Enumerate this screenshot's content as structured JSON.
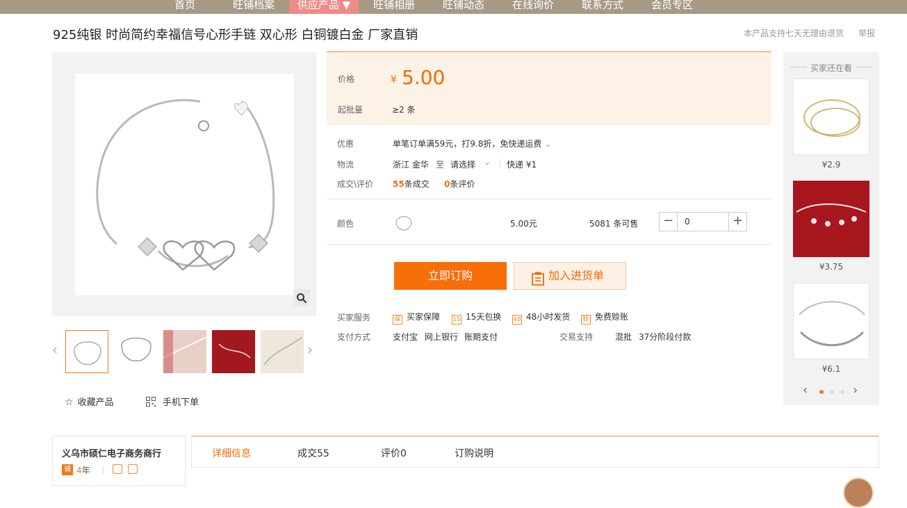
{
  "nav": {
    "items": [
      "首页",
      "旺铺档案",
      "供应产品 ▼",
      "旺铺相册",
      "旺铺动态",
      "在线询价",
      "联系方式",
      "会员专区"
    ]
  },
  "product": {
    "title": "925纯银 时尚简约幸福信号心形手链 双心形 白铜镀白金 厂家直销",
    "return_policy": "本产品支持七天无理由退货",
    "report": "举报"
  },
  "actions": {
    "favorite": "收藏产品",
    "mobile_order": "手机下单"
  },
  "price": {
    "label": "价格",
    "currency": "¥",
    "value": "5.00",
    "moq_label": "起批量",
    "moq_value": "≥2 条"
  },
  "promo": {
    "label": "优惠",
    "text": "单笔订单满59元，打9.8折，免快递运费"
  },
  "logistics": {
    "label": "物流",
    "from": "浙江 金华",
    "to_word": "至",
    "select": "请选择",
    "express": "快递 ¥1"
  },
  "deals": {
    "label": "成交\\评价",
    "sold_count": "55",
    "sold_suffix": "条成交",
    "review_count": "0",
    "review_suffix": "条评价"
  },
  "variant": {
    "label": "颜色",
    "price": "5.00元",
    "stock": "5081 条可售",
    "qty": "0",
    "minus": "−",
    "plus": "+"
  },
  "buttons": {
    "buy": "立即订购",
    "cart": "加入进货单"
  },
  "services": {
    "label": "买家服务",
    "items": [
      {
        "icon": "保",
        "text": "买家保障"
      },
      {
        "icon": "15",
        "text": "15天包换"
      },
      {
        "icon": "48",
        "text": "48小时发货"
      },
      {
        "icon": "赊",
        "text": "免费赊账"
      }
    ]
  },
  "payment": {
    "label": "支付方式",
    "methods": [
      "支付宝",
      "网上银行",
      "账期支付"
    ],
    "trade_label": "交易支持",
    "trade_methods": [
      "混批",
      "37分阶段付款"
    ]
  },
  "also_viewing": {
    "title": "买家还在看",
    "items": [
      {
        "price": "¥2.9"
      },
      {
        "price": "¥3.75"
      },
      {
        "price": "¥6.1"
      }
    ]
  },
  "store": {
    "name": "义乌市硕仁电子商务商行",
    "badge": "诚",
    "years": "4",
    "years_suffix": "年"
  },
  "tabs": [
    "详细信息",
    "成交55",
    "评价0",
    "订购说明"
  ],
  "colors": {
    "accent": "#f86e09",
    "nav_bg": "#a79a85",
    "nav_active": "#f08a86",
    "price_bg": "#fdf2e6"
  }
}
